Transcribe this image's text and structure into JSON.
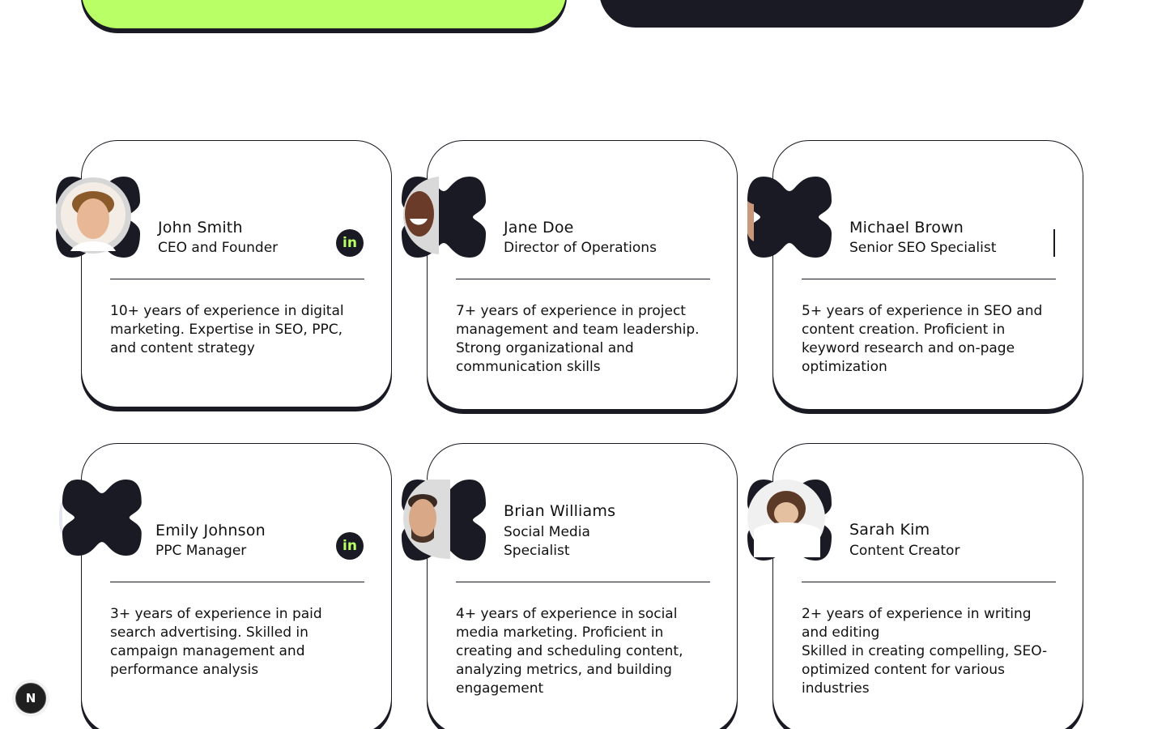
{
  "colors": {
    "accent": "#b9ff66",
    "dark": "#191a23",
    "background": "#ffffff"
  },
  "team": [
    {
      "name": "John Smith",
      "role": "CEO and Founder",
      "bio": "10+ years of experience in digital marketing. Expertise in SEO, PPC, and content strategy",
      "icon": "linkedin-icon",
      "linkedin_label": "in"
    },
    {
      "name": "Jane Doe",
      "role": "Director of Operations",
      "bio": "7+ years of experience in project management and team leadership. Strong organizational and communication skills",
      "icon": "linkedin-icon",
      "linkedin_label": ""
    },
    {
      "name": "Michael Brown",
      "role": "Senior SEO Specialist",
      "bio": "5+ years of experience in SEO and content creation. Proficient in keyword research and on-page optimization",
      "icon": "linkedin-icon",
      "linkedin_label": ""
    },
    {
      "name": "Emily Johnson",
      "role": "PPC Manager",
      "bio": "3+ years of experience in paid search advertising. Skilled in campaign management and performance analysis",
      "icon": "linkedin-icon",
      "linkedin_label": "in"
    },
    {
      "name": "Brian Williams",
      "role": "Social Media Specialist",
      "bio": "4+ years of experience in social media marketing. Proficient in creating and scheduling content, analyzing metrics, and building engagement",
      "icon": "linkedin-icon",
      "linkedin_label": ""
    },
    {
      "name": "Sarah Kim",
      "role": "Content Creator",
      "bio": "2+ years of experience in writing and editing\nSkilled in creating compelling, SEO-optimized content for various industries",
      "icon": "linkedin-icon",
      "linkedin_label": ""
    }
  ],
  "dev_badge": {
    "label": "N",
    "icon": "nextjs-icon"
  }
}
